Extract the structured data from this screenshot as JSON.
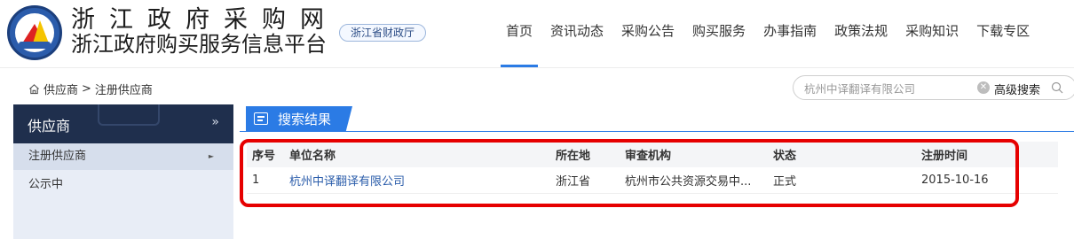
{
  "header": {
    "title_line1": "浙江政府采购网",
    "title_line2": "浙江政府购买服务信息平台",
    "dept_badge": "浙江省财政厅"
  },
  "nav": [
    {
      "label": "首页",
      "active": true
    },
    {
      "label": "资讯动态"
    },
    {
      "label": "采购公告"
    },
    {
      "label": "购买服务"
    },
    {
      "label": "办事指南"
    },
    {
      "label": "政策法规"
    },
    {
      "label": "采购知识"
    },
    {
      "label": "下载专区"
    }
  ],
  "breadcrumb": {
    "root": "供应商",
    "separator": ">",
    "current": "注册供应商"
  },
  "search": {
    "value": "杭州中译翻译有限公司",
    "advanced_label": "高级搜索"
  },
  "sidebar": {
    "title": "供应商",
    "toggle": "»",
    "items": [
      {
        "label": "注册供应商",
        "active": true,
        "marker": "►"
      },
      {
        "label": "公示中"
      }
    ]
  },
  "results": {
    "tab_label": "搜索结果",
    "columns": [
      "序号",
      "单位名称",
      "所在地",
      "审查机构",
      "状态",
      "注册时间"
    ],
    "rows": [
      [
        "1",
        "杭州中译翻译有限公司",
        "浙江省",
        "杭州市公共资源交易中...",
        "正式",
        "2015-10-16"
      ]
    ]
  },
  "colors": {
    "accent": "#2b7be5",
    "sidebar_header": "#1f2f4d",
    "highlight": "#e60000",
    "link": "#2a5caa"
  }
}
